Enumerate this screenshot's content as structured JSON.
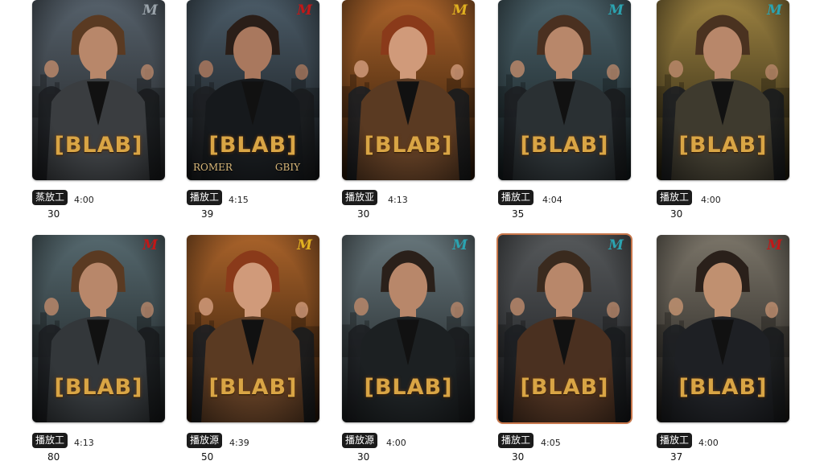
{
  "cards": [
    {
      "logo": "M",
      "logo_color": "#9aa3aa",
      "title": "[BLAB]",
      "badge": "蒸放工",
      "count": "30",
      "duration": "4:00",
      "credit_left": "",
      "credit_right": "",
      "bg_top": "#55606a",
      "bg_bottom": "#1e1f20",
      "jacket": "#3a3d40",
      "skin": "#b8876a",
      "hair": "#5a3a22",
      "framed": false
    },
    {
      "logo": "M",
      "logo_color": "#c01818",
      "title": "[BLAB]",
      "badge": "播放工",
      "count": "39",
      "duration": "4:15",
      "credit_left": "ROMER",
      "credit_right": "GBIY",
      "bg_top": "#4a5a66",
      "bg_bottom": "#121416",
      "jacket": "#16191c",
      "skin": "#a9785e",
      "hair": "#2a1e18",
      "framed": false
    },
    {
      "logo": "M",
      "logo_color": "#e0b020",
      "title": "[BLAB]",
      "badge": "播放亚",
      "count": "30",
      "duration": "4:13",
      "credit_left": "",
      "credit_right": "",
      "bg_top": "#a8622a",
      "bg_bottom": "#241406",
      "jacket": "#5a3a22",
      "skin": "#d09a7a",
      "hair": "#8a3a1a",
      "framed": false
    },
    {
      "logo": "M",
      "logo_color": "#2ba3b0",
      "title": "[BLAB]",
      "badge": "播放工",
      "count": "35",
      "duration": "4:04",
      "credit_left": "",
      "credit_right": "",
      "bg_top": "#4a6068",
      "bg_bottom": "#121a1c",
      "jacket": "#2a3033",
      "skin": "#b8876a",
      "hair": "#4a3020",
      "framed": false
    },
    {
      "logo": "M",
      "logo_color": "#2ba3b0",
      "title": "[BLAB]",
      "badge": "播放工",
      "count": "30",
      "duration": "4:00",
      "credit_left": "",
      "credit_right": "",
      "bg_top": "#9a8040",
      "bg_bottom": "#1e1a0c",
      "jacket": "#3e3a2e",
      "skin": "#b8876a",
      "hair": "#4a3220",
      "framed": false
    },
    {
      "logo": "M",
      "logo_color": "#c01818",
      "title": "[BLAB]",
      "badge": "播放工",
      "count": "80",
      "duration": "4:13",
      "credit_left": "",
      "credit_right": "",
      "bg_top": "#55686e",
      "bg_bottom": "#16191a",
      "jacket": "#33373a",
      "skin": "#b8876a",
      "hair": "#5a3a22",
      "framed": false
    },
    {
      "logo": "M",
      "logo_color": "#e0b020",
      "title": "[BLAB]",
      "badge": "播放源",
      "count": "50",
      "duration": "4:39",
      "credit_left": "",
      "credit_right": "",
      "bg_top": "#a8622a",
      "bg_bottom": "#241406",
      "jacket": "#5a3a22",
      "skin": "#d09a7a",
      "hair": "#8a3a1a",
      "framed": false
    },
    {
      "logo": "M",
      "logo_color": "#2ba3b0",
      "title": "[BLAB]",
      "badge": "播放源",
      "count": "30",
      "duration": "4:00",
      "credit_left": "",
      "credit_right": "",
      "bg_top": "#66757a",
      "bg_bottom": "#161a1c",
      "jacket": "#1c2022",
      "skin": "#b8876a",
      "hair": "#2a201a",
      "framed": false
    },
    {
      "logo": "M",
      "logo_color": "#2ba3b0",
      "title": "[BLAB]",
      "badge": "播放工",
      "count": "30",
      "duration": "4:05",
      "credit_left": "",
      "credit_right": "",
      "bg_top": "#55585a",
      "bg_bottom": "#16171a",
      "jacket": "#4a3020",
      "skin": "#b8876a",
      "hair": "#3a2a1e",
      "framed": true
    },
    {
      "logo": "M",
      "logo_color": "#c01818",
      "title": "[BLAB]",
      "badge": "播放工",
      "count": "37",
      "duration": "4:00",
      "credit_left": "",
      "credit_right": "",
      "bg_top": "#7a7468",
      "bg_bottom": "#1a1816",
      "jacket": "#1e2024",
      "skin": "#c09070",
      "hair": "#2a201a",
      "framed": false
    }
  ]
}
